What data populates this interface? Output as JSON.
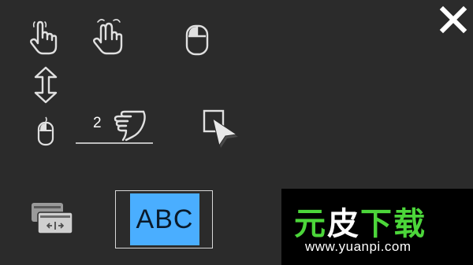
{
  "toolbar": {
    "close_icon": "close-icon",
    "gestures": [
      {
        "name": "tap",
        "icon": "finger-tap-icon"
      },
      {
        "name": "two-finger",
        "icon": "two-finger-icon"
      },
      {
        "name": "mouse",
        "icon": "mouse-icon"
      },
      {
        "name": "scroll",
        "icon": "up-down-arrow-icon"
      },
      {
        "name": "small-mouse",
        "icon": "small-mouse-icon"
      },
      {
        "name": "two-finger-swipe",
        "icon": "swipe-hand-icon",
        "count": "2"
      },
      {
        "name": "pointer",
        "icon": "pointer-cursor-icon"
      },
      {
        "name": "screens",
        "icon": "screens-icon"
      }
    ]
  },
  "keyboard": {
    "label": "ABC",
    "accent_color": "#4aaeff"
  },
  "watermark": {
    "brand_part1": "元",
    "brand_part2": "皮",
    "brand_part3": "下载",
    "url": "www.yuanpi.com",
    "brand_color": "#4cd63a"
  },
  "colors": {
    "background": "#2b2b2b",
    "icon": "#d9d9d9"
  }
}
